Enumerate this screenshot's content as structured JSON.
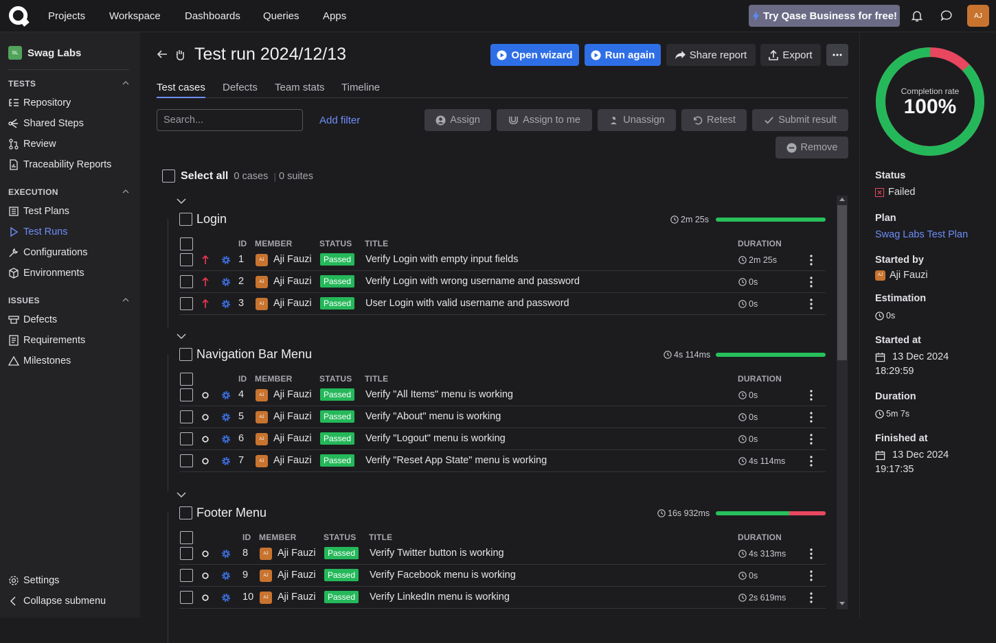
{
  "topnav": {
    "items": [
      "Projects",
      "Workspace",
      "Dashboards",
      "Queries",
      "Apps"
    ],
    "promo_label": "Try Qase Business for free!",
    "avatar_initials": "AJ"
  },
  "sidebar": {
    "project_name": "Swag Labs",
    "project_initials": "SL",
    "sections": {
      "tests": "TESTS",
      "execution": "EXECUTION",
      "issues": "ISSUES"
    },
    "tests_items": [
      "Repository",
      "Shared Steps",
      "Review",
      "Traceability Reports"
    ],
    "execution_items": [
      "Test Plans",
      "Test Runs",
      "Configurations",
      "Environments"
    ],
    "issues_items": [
      "Defects",
      "Requirements",
      "Milestones"
    ],
    "settings_label": "Settings",
    "collapse_label": "Collapse submenu"
  },
  "header": {
    "title": "Test run 2024/12/13",
    "open_wizard": "Open wizard",
    "run_again": "Run again",
    "share_report": "Share report",
    "export": "Export"
  },
  "tabs": [
    "Test cases",
    "Defects",
    "Team stats",
    "Timeline"
  ],
  "toolbar": {
    "search_placeholder": "Search...",
    "add_filter": "Add filter",
    "assign": "Assign",
    "assign_to_me": "Assign to me",
    "unassign": "Unassign",
    "retest": "Retest",
    "submit_result": "Submit result",
    "remove": "Remove"
  },
  "select_all": {
    "label": "Select all",
    "cases": "0 cases",
    "suites": "0 suites"
  },
  "columns": {
    "id": "ID",
    "member": "MEMBER",
    "status": "STATUS",
    "title": "TITLE",
    "duration": "DURATION"
  },
  "suites": [
    {
      "name": "Login",
      "duration": "2m 25s",
      "passed_fraction": 1.0,
      "rows": [
        {
          "id": "1",
          "member": "Aji Fauzi",
          "member_initials": "AJ",
          "status": "Passed",
          "title": "Verify Login with empty input fields",
          "duration": "2m 25s",
          "priority_icon": "arrow-up-icon"
        },
        {
          "id": "2",
          "member": "Aji Fauzi",
          "member_initials": "AJ",
          "status": "Passed",
          "title": "Verify Login with wrong username and password",
          "duration": "0s",
          "priority_icon": "arrow-up-icon"
        },
        {
          "id": "3",
          "member": "Aji Fauzi",
          "member_initials": "AJ",
          "status": "Passed",
          "title": "User Login with valid username and password",
          "duration": "0s",
          "priority_icon": "arrow-up-icon"
        }
      ]
    },
    {
      "name": "Navigation Bar Menu",
      "duration": "4s 114ms",
      "passed_fraction": 1.0,
      "rows": [
        {
          "id": "4",
          "member": "Aji Fauzi",
          "member_initials": "AJ",
          "status": "Passed",
          "title": "Verify \"All Items\" menu is working",
          "duration": "0s",
          "priority_icon": "circle-icon"
        },
        {
          "id": "5",
          "member": "Aji Fauzi",
          "member_initials": "AJ",
          "status": "Passed",
          "title": "Verify \"About\" menu is working",
          "duration": "0s",
          "priority_icon": "circle-icon"
        },
        {
          "id": "6",
          "member": "Aji Fauzi",
          "member_initials": "AJ",
          "status": "Passed",
          "title": "Verify \"Logout\" menu is working",
          "duration": "0s",
          "priority_icon": "circle-icon"
        },
        {
          "id": "7",
          "member": "Aji Fauzi",
          "member_initials": "AJ",
          "status": "Passed",
          "title": "Verify \"Reset App State\" menu is working",
          "duration": "4s 114ms",
          "priority_icon": "circle-icon"
        }
      ]
    },
    {
      "name": "Footer Menu",
      "duration": "16s 932ms",
      "passed_fraction": 0.67,
      "rows": [
        {
          "id": "8",
          "member": "Aji Fauzi",
          "member_initials": "AJ",
          "status": "Passed",
          "title": "Verify Twitter button is working",
          "duration": "4s 313ms",
          "priority_icon": "circle-icon"
        },
        {
          "id": "9",
          "member": "Aji Fauzi",
          "member_initials": "AJ",
          "status": "Passed",
          "title": "Verify Facebook menu is working",
          "duration": "0s",
          "priority_icon": "circle-icon"
        },
        {
          "id": "10",
          "member": "Aji Fauzi",
          "member_initials": "AJ",
          "status": "Passed",
          "title": "Verify LinkedIn menu is working",
          "duration": "2s 619ms",
          "priority_icon": "circle-icon"
        }
      ]
    }
  ],
  "details": {
    "completion_label": "Completion rate",
    "completion_value": "100%",
    "passed_fraction": 0.87,
    "status_label": "Status",
    "status_value": "Failed",
    "plan_label": "Plan",
    "plan_value": "Swag Labs Test Plan",
    "started_by_label": "Started by",
    "started_by_value": "Aji Fauzi",
    "estimation_label": "Estimation",
    "estimation_value": "0s",
    "started_at_label": "Started at",
    "started_at_date": "13 Dec 2024",
    "started_at_time": "18:29:59",
    "duration_label": "Duration",
    "duration_value": "5m 7s",
    "finished_at_label": "Finished at",
    "finished_at_date": "13 Dec 2024",
    "finished_at_time": "19:17:35"
  },
  "colors": {
    "accent": "#2f6fe6",
    "link": "#6f8df7",
    "passed": "#25b85a",
    "failed": "#e8475f"
  }
}
